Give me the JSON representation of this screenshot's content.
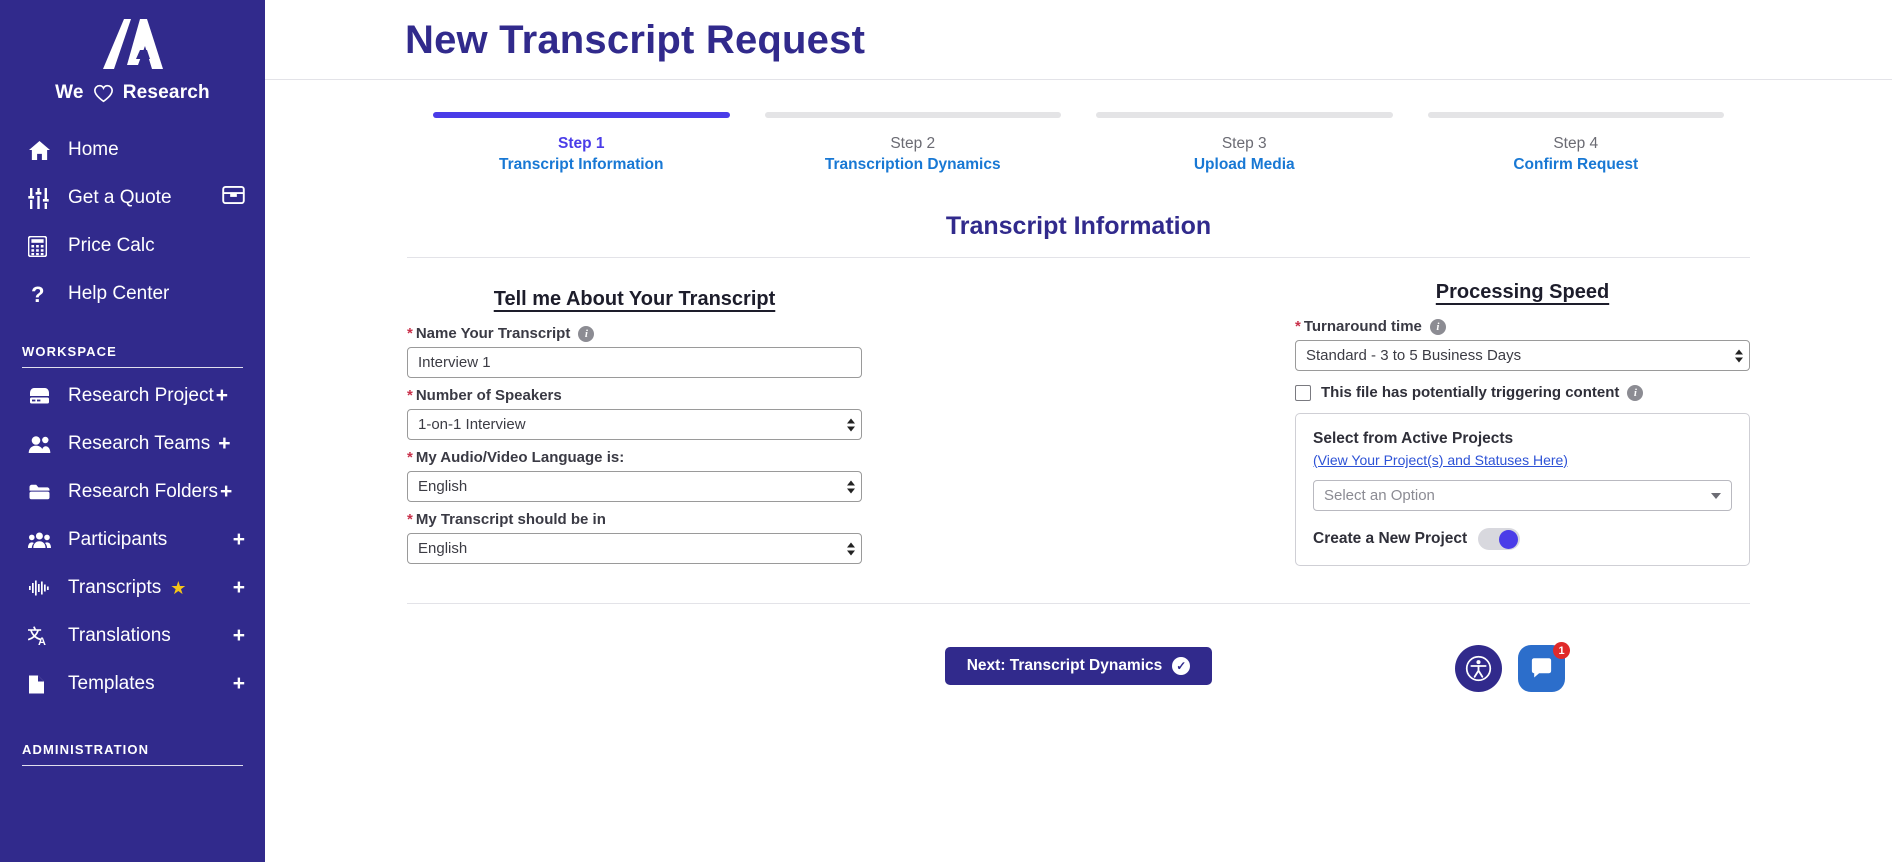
{
  "sidebar": {
    "brand": {
      "pre": "We",
      "icon": "heart-icon",
      "post": "Research"
    },
    "primary": [
      {
        "label": "Home",
        "icon": "home-icon",
        "trail": ""
      },
      {
        "label": "Get a Quote",
        "icon": "sliders-icon",
        "trail": "inbox-icon"
      },
      {
        "label": "Price Calc",
        "icon": "calculator-icon",
        "trail": ""
      },
      {
        "label": "Help Center",
        "icon": "question-icon",
        "trail": ""
      }
    ],
    "workspace_header": "WORKSPACE",
    "workspace": [
      {
        "label": "Research Project",
        "icon": "server-icon",
        "plus": "+",
        "tight": true
      },
      {
        "label": "Research Teams",
        "icon": "users-icon",
        "plus": "+",
        "tight": true
      },
      {
        "label": "Research Folders",
        "icon": "folder-icon",
        "plus": "+",
        "tight": true
      },
      {
        "label": "Participants",
        "icon": "people-group-icon",
        "plus": "+",
        "tight": false
      },
      {
        "label": "Transcripts",
        "icon": "waveform-icon",
        "plus": "+",
        "tight": false,
        "star": "★"
      },
      {
        "label": "Translations",
        "icon": "translate-icon",
        "plus": "+",
        "tight": false
      },
      {
        "label": "Templates",
        "icon": "document-icon",
        "plus": "+",
        "tight": false
      }
    ],
    "administration_header": "ADMINISTRATION"
  },
  "header": {
    "title": "New Transcript Request"
  },
  "stepper": [
    {
      "num": "Step 1",
      "caption": "Transcript Information",
      "active": true
    },
    {
      "num": "Step 2",
      "caption": "Transcription Dynamics",
      "active": false
    },
    {
      "num": "Step 3",
      "caption": "Upload Media",
      "active": false
    },
    {
      "num": "Step 4",
      "caption": "Confirm Request",
      "active": false
    }
  ],
  "form": {
    "title": "Transcript Information",
    "left": {
      "heading": "Tell me About Your Transcript",
      "name_label": "Name Your Transcript",
      "name_value": "Interview 1",
      "speakers_label": "Number of Speakers",
      "speakers_value": "1-on-1 Interview",
      "audio_lang_label": "My Audio/Video Language is:",
      "audio_lang_value": "English",
      "transcript_lang_label": "My Transcript should be in",
      "transcript_lang_value": "English"
    },
    "right": {
      "heading": "Processing Speed",
      "turnaround_label": "Turnaround time",
      "turnaround_value": "Standard - 3 to 5 Business Days",
      "trigger_checkbox_label": "This file has potentially triggering content",
      "panel_title": "Select from Active Projects",
      "panel_link": "(View Your Project(s) and Statuses Here)",
      "project_placeholder": "Select an Option",
      "new_project_label": "Create a New Project"
    }
  },
  "footer": {
    "next_label": "Next: Transcript Dynamics"
  },
  "widgets": {
    "chat_badge": "1"
  },
  "colors": {
    "brand_purple": "#312a8c",
    "accent_indigo": "#4a3ce8",
    "link_blue": "#1878d4",
    "required_red": "#c9304a",
    "badge_red": "#e02a2a",
    "chat_blue": "#2c6ecb",
    "star_gold": "#f5c518"
  }
}
